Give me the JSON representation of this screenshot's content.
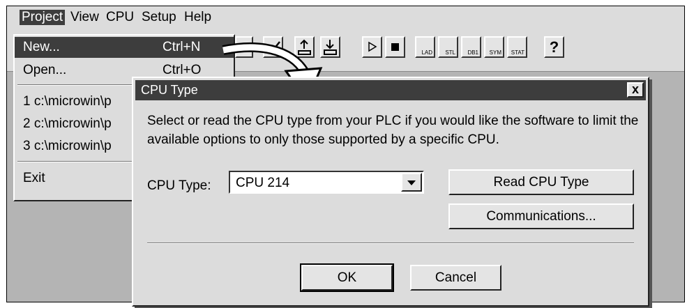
{
  "menubar": {
    "items": [
      {
        "label": "Project",
        "active": true
      },
      {
        "label": "View",
        "active": false
      },
      {
        "label": "CPU",
        "active": false
      },
      {
        "label": "Setup",
        "active": false
      },
      {
        "label": "Help",
        "active": false
      }
    ]
  },
  "project_menu": {
    "items": [
      {
        "label": "New...",
        "shortcut": "Ctrl+N",
        "highlighted": true
      },
      {
        "label": "Open...",
        "shortcut": "Ctrl+O",
        "highlighted": false
      },
      {
        "label": "1  c:\\microwin\\p",
        "shortcut": ""
      },
      {
        "label": "2  c:\\microwin\\p",
        "shortcut": ""
      },
      {
        "label": "3  c:\\microwin\\p",
        "shortcut": ""
      },
      {
        "label": "Exit",
        "shortcut": ""
      }
    ]
  },
  "toolbar": {
    "buttons": [
      {
        "name": "page-icon",
        "label": ""
      },
      {
        "name": "check-icon",
        "label": ""
      },
      {
        "name": "upload-icon",
        "label": ""
      },
      {
        "name": "download-icon",
        "label": ""
      },
      {
        "name": "run-icon",
        "label": ""
      },
      {
        "name": "stop-icon",
        "label": ""
      },
      {
        "name": "ladder-icon",
        "label": "LAD"
      },
      {
        "name": "stl-icon",
        "label": "STL"
      },
      {
        "name": "db1-icon",
        "label": "DB1"
      },
      {
        "name": "sym-icon",
        "label": "SYM"
      },
      {
        "name": "stat-icon",
        "label": "STAT"
      },
      {
        "name": "help-icon",
        "label": "?"
      }
    ]
  },
  "dialog": {
    "title": "CPU Type",
    "close_label": "x",
    "description": "Select or read the CPU type from your PLC if you would like the software to limit the available options to only those supported by a specific CPU.",
    "cpu_type_label": "CPU Type:",
    "cpu_type_value": "CPU 214",
    "read_button": "Read CPU Type",
    "communications_button": "Communications...",
    "ok_button": "OK",
    "cancel_button": "Cancel"
  }
}
